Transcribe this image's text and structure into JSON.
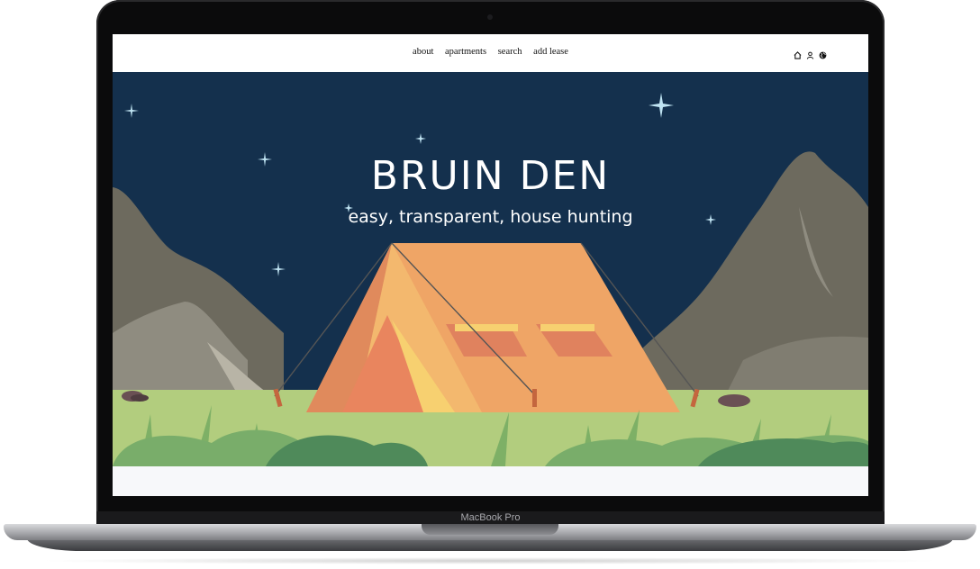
{
  "device": {
    "model_label": "MacBook Pro"
  },
  "nav": {
    "links": [
      "about",
      "apartments",
      "search",
      "add lease"
    ],
    "icons": [
      "home-icon",
      "user-icon",
      "globe-icon"
    ]
  },
  "hero": {
    "title": "BRUIN DEN",
    "subtitle": "easy, transparent, house hunting"
  },
  "colors": {
    "sky": "#14304d",
    "mountain": "#6d6a5e",
    "grass": "#b2cd7e",
    "tent": "#efa566",
    "bush_dark": "#4f8a5a"
  }
}
